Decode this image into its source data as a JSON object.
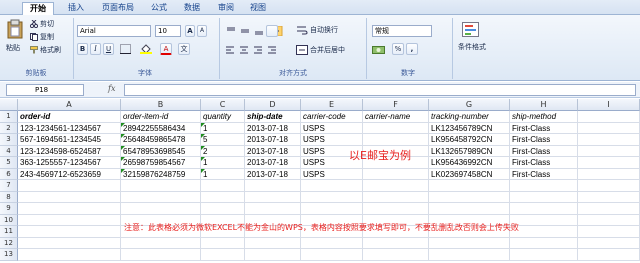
{
  "tabs": [
    "开始",
    "插入",
    "页面布局",
    "公式",
    "数据",
    "审阅",
    "视图"
  ],
  "ribbon": {
    "clipboard": {
      "paste": "粘贴",
      "cut": "剪切",
      "copy": "复制",
      "format_painter": "格式刷",
      "label": "剪贴板"
    },
    "font": {
      "name": "Arial",
      "size": "10",
      "label": "字体",
      "bold": "B",
      "italic": "I",
      "underline": "U",
      "grow": "A",
      "shrink": "A",
      "color_a": "A",
      "wen": "文"
    },
    "alignment": {
      "wrap": "自动换行",
      "merge": "合并后居中",
      "label": "对齐方式"
    },
    "number": {
      "format": "常规",
      "percent": "%",
      "comma": ",",
      "label": "数字"
    },
    "styles": {
      "conditional": "条件格式"
    }
  },
  "formula_bar": {
    "name_box": "P18",
    "fx": "fx",
    "value": ""
  },
  "columns": [
    "A",
    "B",
    "C",
    "D",
    "E",
    "F",
    "G",
    "H",
    "I"
  ],
  "rows": [
    "1",
    "2",
    "3",
    "4",
    "5",
    "6",
    "7",
    "8",
    "9",
    "10",
    "11",
    "12",
    "13"
  ],
  "table": {
    "headers": [
      "order-id",
      "order-item-id",
      "quantity",
      "ship-date",
      "carrier-code",
      "carrier-name",
      "tracking-number",
      "ship-method"
    ],
    "data": [
      [
        "123-1234561-1234567",
        "28942255586434",
        "1",
        "2013-07-18",
        "USPS",
        "",
        "LK123456789CN",
        "First-Class"
      ],
      [
        "567-1694561-1234545",
        "25648459865478",
        "5",
        "2013-07-18",
        "USPS",
        "",
        "LK956458792CN",
        "First-Class"
      ],
      [
        "123-1234598-6524587",
        "65478953698545",
        "2",
        "2013-07-18",
        "USPS",
        "",
        "LK132657989CN",
        "First-Class"
      ],
      [
        "363-1255557-1234567",
        "26598759854567",
        "1",
        "2013-07-18",
        "USPS",
        "",
        "LK956436992CN",
        "First-Class"
      ],
      [
        "243-4569712-6523659",
        "32159876248759",
        "1",
        "2013-07-18",
        "USPS",
        "",
        "LK023697458CN",
        "First-Class"
      ]
    ]
  },
  "annotations": {
    "example": "以E邮宝为例",
    "notice": "注意：此表格必须为微软EXCEL不能为金山的WPS，表格内容按照要求填写即可，不要乱删乱改否则会上传失败"
  },
  "colors": {
    "annotation": "#e8201e",
    "text_flag": "#1e8c1e",
    "ribbon_accent": "#15428b"
  }
}
